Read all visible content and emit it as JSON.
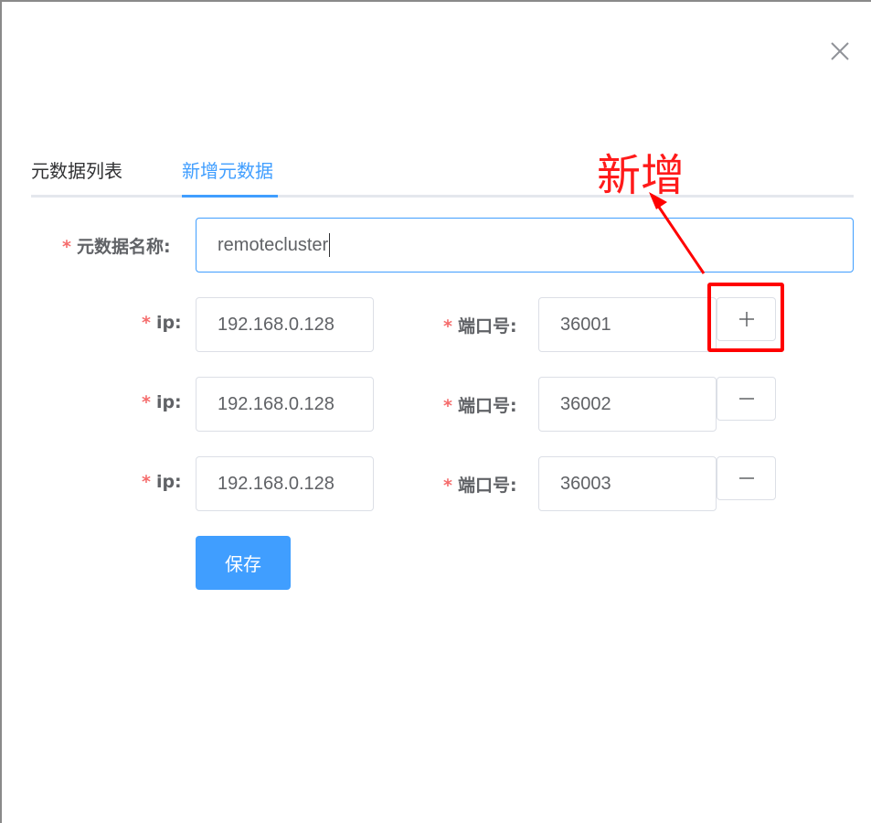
{
  "tabs": [
    {
      "label": "元数据列表",
      "active": false
    },
    {
      "label": "新增元数据",
      "active": true
    }
  ],
  "form": {
    "required_mark": "*",
    "name_label": "元数据名称:",
    "name_value": "remotecluster",
    "ip_label": "ip:",
    "port_label": "端口号:",
    "rows": [
      {
        "ip": "192.168.0.128",
        "port": "36001",
        "action": "plus-icon"
      },
      {
        "ip": "192.168.0.128",
        "port": "36002",
        "action": "minus-icon"
      },
      {
        "ip": "192.168.0.128",
        "port": "36003",
        "action": "minus-icon"
      }
    ],
    "save_label": "保存"
  },
  "annotation": {
    "text": "新增",
    "color": "#ff0000"
  },
  "colors": {
    "primary": "#409eff",
    "required": "#f56c6c",
    "annotation": "#ff0000"
  }
}
